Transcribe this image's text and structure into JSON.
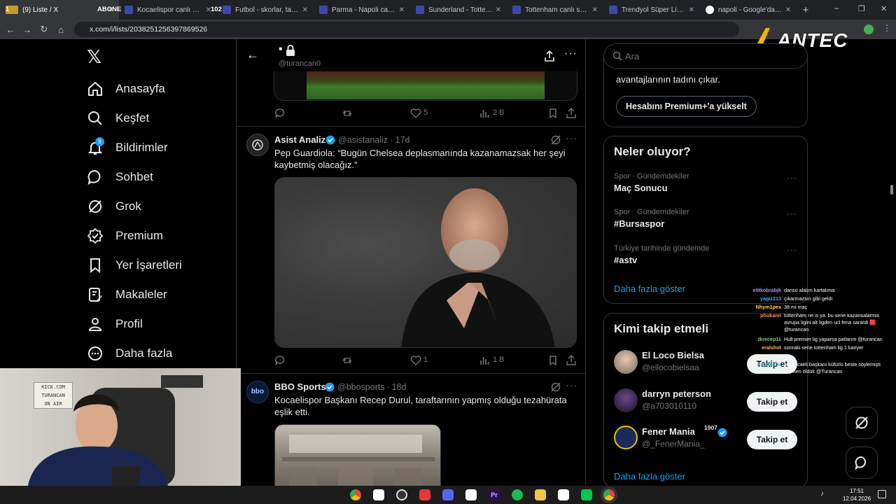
{
  "browser": {
    "tabs": [
      {
        "title": "(9) Liste / X",
        "prefix": "1",
        "fav_color": "#000000",
        "active": true
      },
      {
        "title": "Kocaelispor canlı skoru, tak",
        "prefix": "ABONE",
        "fav_color": "#3949ab"
      },
      {
        "title": "Futbol - skorlar, takvim &",
        "prefix": "102",
        "fav_color": "#3949ab"
      },
      {
        "title": "Parma - Napoli canlı skor",
        "prefix": "",
        "fav_color": "#3949ab"
      },
      {
        "title": "Sunderland - Tottenham",
        "prefix": "",
        "fav_color": "#3949ab"
      },
      {
        "title": "Tottenham canlı skoru, ta",
        "prefix": "",
        "fav_color": "#3949ab"
      },
      {
        "title": "Trendyol Süper Lig puan",
        "prefix": "",
        "fav_color": "#3949ab"
      },
      {
        "title": "napoli - Google'da Ara",
        "prefix": "",
        "fav_color": "#ffffff"
      }
    ],
    "new_tab": "+",
    "url": "x.com/i/lists/2038251256397869526",
    "window_controls": [
      "–",
      "❐",
      "✕"
    ]
  },
  "overlay_logo": "ANTEC",
  "sidebar": {
    "logo": "𝕏",
    "items": [
      {
        "label": "Anasayfa",
        "icon": "home-icon"
      },
      {
        "label": "Keşfet",
        "icon": "search-icon"
      },
      {
        "label": "Bildirimler",
        "icon": "bell-icon",
        "badge": "9"
      },
      {
        "label": "Sohbet",
        "icon": "chat-icon"
      },
      {
        "label": "Grok",
        "icon": "grok-icon"
      },
      {
        "label": "Premium",
        "icon": "premium-icon"
      },
      {
        "label": "Yer İşaretleri",
        "icon": "bookmark-icon"
      },
      {
        "label": "Makaleler",
        "icon": "article-icon"
      },
      {
        "label": "Profil",
        "icon": "profile-icon"
      },
      {
        "label": "Daha fazla",
        "icon": "more-circle-icon"
      }
    ]
  },
  "header": {
    "title": "•",
    "handle": "@turancan0"
  },
  "tweets": [
    {
      "actions": {
        "reply": "",
        "retweet": "",
        "like": "5",
        "views": "2 B"
      }
    },
    {
      "name": "Asist Analiz",
      "handle": "@asistanaliz",
      "time": "· 17d",
      "text": "Pep Guardiola: “Bugün Chelsea deplasmanında kazanamazsak her şeyi kaybetmiş olacağız.”",
      "actions": {
        "reply": "",
        "retweet": "",
        "like": "1",
        "views": "1 B"
      }
    },
    {
      "name": "BBO Sports",
      "handle": "@bbosports",
      "time": "· 18d",
      "text": "Kocaelispor Başkanı Recep Durul, taraftarının yapmış olduğu tezahürata eşlik etti."
    }
  ],
  "right": {
    "search_placeholder": "Ara",
    "premium_text": "avantajlarının tadını çıkar.",
    "premium_button": "Hesabını Premium+'a yükselt",
    "trends_title": "Neler oluyor?",
    "trends": [
      {
        "category": "Spor · Gündemdekiler",
        "name": "Maç Sonucu"
      },
      {
        "category": "Spor · Gündemdekiler",
        "name": "#Bursaspor"
      },
      {
        "category": "Türkiye tarihinde gündemde",
        "name": "#astv"
      }
    ],
    "show_more": "Daha fazla göster",
    "follow_title": "Kimi takip etmeli",
    "suggestions": [
      {
        "name": "El Loco Bielsa",
        "handle": "@ellocobielsaa",
        "verified": false,
        "sup": ""
      },
      {
        "name": "darryn peterson",
        "handle": "@a703010110",
        "verified": false,
        "sup": ""
      },
      {
        "name": "Fener Mania",
        "handle": "@_FenerMania_",
        "verified": true,
        "sup": "1907"
      }
    ],
    "follow_button": "Takip et",
    "show_more_2": "Daha fazla göster"
  },
  "chat": [
    {
      "user": "elitkobrabjk",
      "msg": "danso alalım kartalıma",
      "color": "#b388ff"
    },
    {
      "user": "yagiz213",
      "msg": "çıkarmazsın gibi geldi",
      "color": "#42a5f5"
    },
    {
      "user": "Nhym1pex",
      "msg": "38 mi maç",
      "color": "#ffd54f"
    },
    {
      "user": "phukann",
      "msg": "tottenham ne is ya. bu sene kazansalarmis avrupa ligini alt ligden ucl fena sarardi 🟥 @turancan",
      "color": "#ff8a65"
    },
    {
      "user": "tkrecep11",
      "msg": "Hull premier lig yaparsa patlarım @turancan",
      "color": "#81c784"
    },
    {
      "user": "eralshot",
      "msg": "sonraki sene tottenham lig 1 kariyer",
      "color": "#ffb74d"
    },
    {
      "user": "Kaanbaba",
      "msg": "abi kocaeli başkanı küfürlü beste söylemişti keyiften öldük @Turancan",
      "color": "#4fc3f7"
    }
  ],
  "webcam": {
    "sign_lines": [
      "KICK.COM",
      "TURANCAN",
      "ON AIR"
    ]
  },
  "taskbar": {
    "time": "17:51",
    "date": "12.04.2026"
  },
  "colors": {
    "accent": "#1d9bf0",
    "verified": "#1d9bf0",
    "link": "#1d9bf0"
  }
}
